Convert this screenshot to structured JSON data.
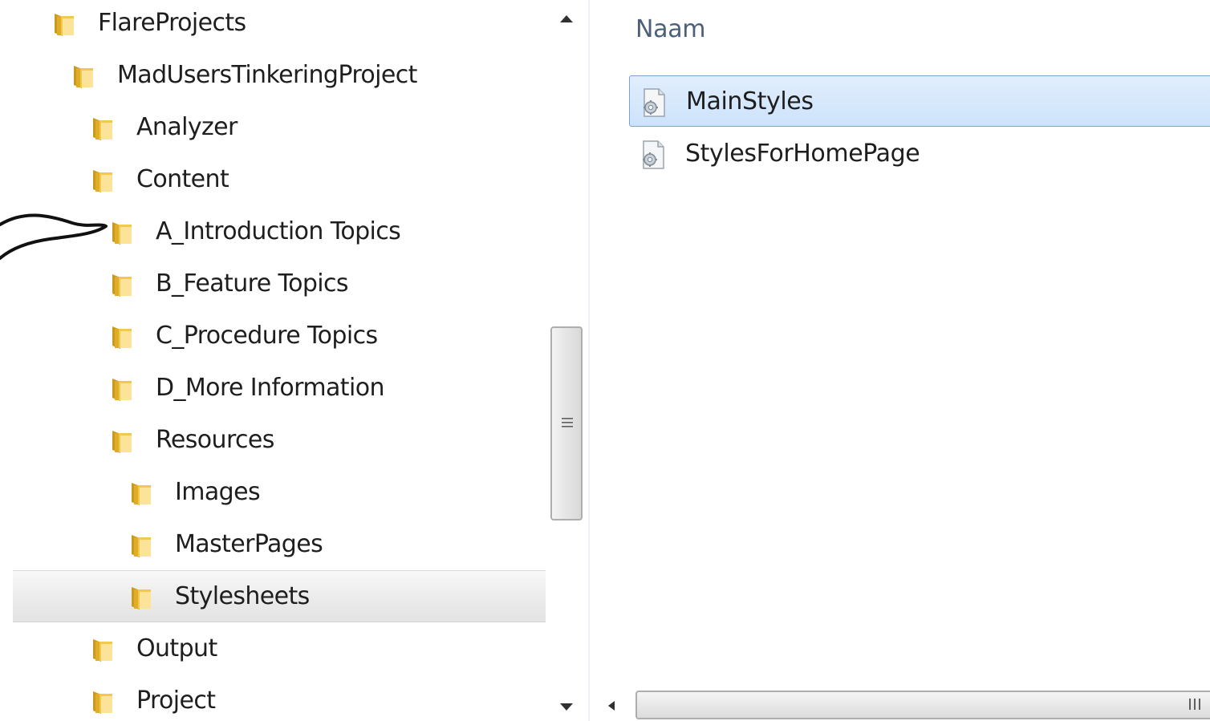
{
  "tree": {
    "items": [
      {
        "label": "FlareProjects",
        "level": 0
      },
      {
        "label": "MadUsersTinkeringProject",
        "level": 1
      },
      {
        "label": "Analyzer",
        "level": 2
      },
      {
        "label": "Content",
        "level": 2
      },
      {
        "label": "A_Introduction Topics",
        "level": 3
      },
      {
        "label": "B_Feature Topics",
        "level": 3
      },
      {
        "label": "C_Procedure Topics",
        "level": 3
      },
      {
        "label": "D_More Information",
        "level": 3
      },
      {
        "label": "Resources",
        "level": 3
      },
      {
        "label": "Images",
        "level": 4
      },
      {
        "label": "MasterPages",
        "level": 4
      },
      {
        "label": "Stylesheets",
        "level": 4,
        "selected": true
      },
      {
        "label": "Output",
        "level": 2
      },
      {
        "label": "Project",
        "level": 2
      }
    ]
  },
  "file_list": {
    "column_header": "Naam",
    "files": [
      {
        "name": "MainStyles",
        "icon": "stylesheet-file-icon",
        "selected": true
      },
      {
        "name": "StylesForHomePage",
        "icon": "stylesheet-file-icon",
        "selected": false
      }
    ]
  },
  "colors": {
    "selection_blue": "#cde3fb",
    "selection_border": "#7da2ce",
    "folder_yellow": "#f2c94c",
    "header_text": "#4c607a"
  }
}
